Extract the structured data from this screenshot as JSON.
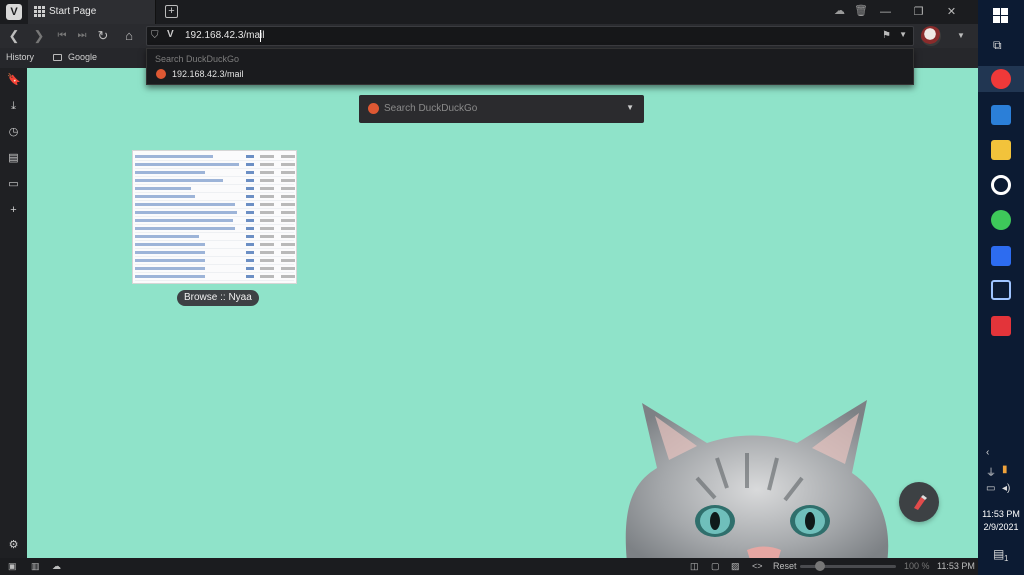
{
  "browser": {
    "tab": {
      "title": "Start Page"
    },
    "window_controls": {
      "minimize": "—",
      "restore": "❐",
      "close": "✕"
    },
    "address_bar": {
      "url": "192.168.42.3/mail"
    },
    "suggestions": {
      "header": "Search DuckDuckGo",
      "items": [
        "192.168.42.3/mail"
      ]
    },
    "bookmarks": {
      "history_label": "History",
      "google_label": "Google"
    },
    "start_page": {
      "search_placeholder": "Search DuckDuckGo",
      "speed_dial": [
        {
          "title": "Browse :: Nyaa"
        }
      ]
    },
    "status_bar": {
      "reset_label": "Reset",
      "zoom": "100 %",
      "clock": "11:53 PM"
    }
  },
  "taskbar": {
    "time": "11:53 PM",
    "date": "2/9/2021",
    "notification_count": "1",
    "apps": [
      "vivaldi",
      "messages",
      "file-explorer",
      "obs",
      "app-green",
      "wps",
      "virtualbox",
      "app-red"
    ]
  },
  "colors": {
    "start_page_bg": "#8fe3c9",
    "vivaldi_red": "#ef3939",
    "taskbar_bg": "#0c1b33",
    "ddg_orange": "#de5833"
  }
}
